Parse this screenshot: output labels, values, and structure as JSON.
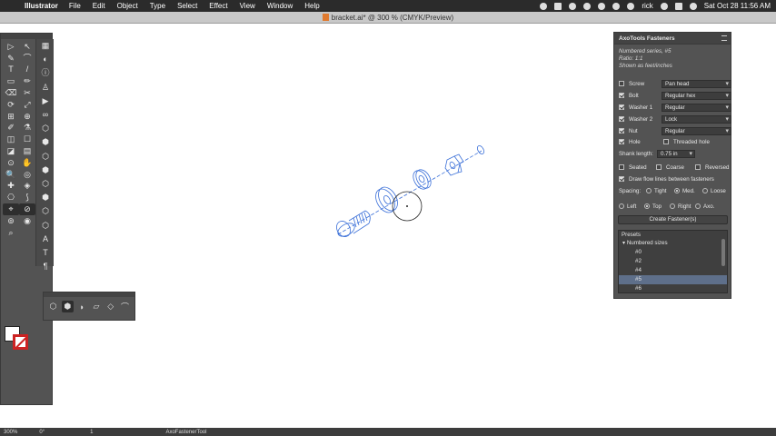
{
  "menubar": {
    "app": "Illustrator",
    "items": [
      "File",
      "Edit",
      "Object",
      "Type",
      "Select",
      "Effect",
      "View",
      "Window",
      "Help"
    ],
    "user": "rick",
    "clock": "Sat Oct 28  11:56 AM"
  },
  "document": {
    "title": "bracket.ai* @ 300 % (CMYK/Preview)"
  },
  "tools": {
    "left": [
      "▷",
      "↖",
      "✎",
      "⌒",
      "T",
      "/",
      "▭",
      "✏",
      "⌫",
      "✂",
      "⟳",
      "⤢",
      "⊞",
      "⊕",
      "✐",
      "⚗",
      "◫",
      "☐",
      "◪",
      "▤",
      "⊙",
      "✋",
      "🔍",
      "◎",
      "✚",
      "◈",
      "⎔",
      "⟆",
      "⌖",
      "⊘",
      "⊚",
      "◉",
      "⌕"
    ],
    "right": [
      "▦",
      "◐",
      "ⓘ",
      "♙",
      "▶",
      "∞",
      "⬡",
      "⬢",
      "⬡",
      "⬢",
      "⬡",
      "⬢",
      "⬡",
      "⬡",
      "A",
      "T",
      "¶"
    ]
  },
  "floatbar": {
    "icons": [
      "cube-icon",
      "box-icon",
      "cylinder-icon",
      "skew-icon",
      "plane-icon",
      "arc-icon"
    ]
  },
  "panel": {
    "title": "AxoTools Fasteners",
    "info": [
      "Numbered series, #5",
      "Ratio: 1:1",
      "Shown as feet/inches"
    ],
    "rows": [
      {
        "label": "Screw",
        "checked": false,
        "value": "Pan head"
      },
      {
        "label": "Bolt",
        "checked": true,
        "value": "Regular hex"
      },
      {
        "label": "Washer 1",
        "checked": true,
        "value": "Regular"
      },
      {
        "label": "Washer 2",
        "checked": true,
        "value": "Lock"
      },
      {
        "label": "Nut",
        "checked": true,
        "value": "Regular"
      }
    ],
    "hole": "Hole",
    "threaded_hole": "Threaded hole",
    "shank_label": "Shank length:",
    "shank_value": "0.75 in",
    "seated": "Seated",
    "coarse": "Coarse",
    "reversed": "Reversed",
    "flow_lines": "Draw flow lines between fasteners",
    "spacing_label": "Spacing:",
    "spacing": [
      "Tight",
      "Med.",
      "Loose"
    ],
    "spacing_selected": "Med.",
    "orient": [
      "Left",
      "Top",
      "Right",
      "Axo."
    ],
    "orient_selected": "Top",
    "create_button": "Create Fastener(s)",
    "presets_label": "Presets",
    "group": "Numbered sizes",
    "presets": [
      "#0",
      "#2",
      "#4",
      "#5",
      "#6"
    ],
    "preset_selected": "#5"
  },
  "statusbar": {
    "zoom": "300%",
    "angle": "0°",
    "page": "1",
    "tool": "AxoFastenerTool"
  }
}
